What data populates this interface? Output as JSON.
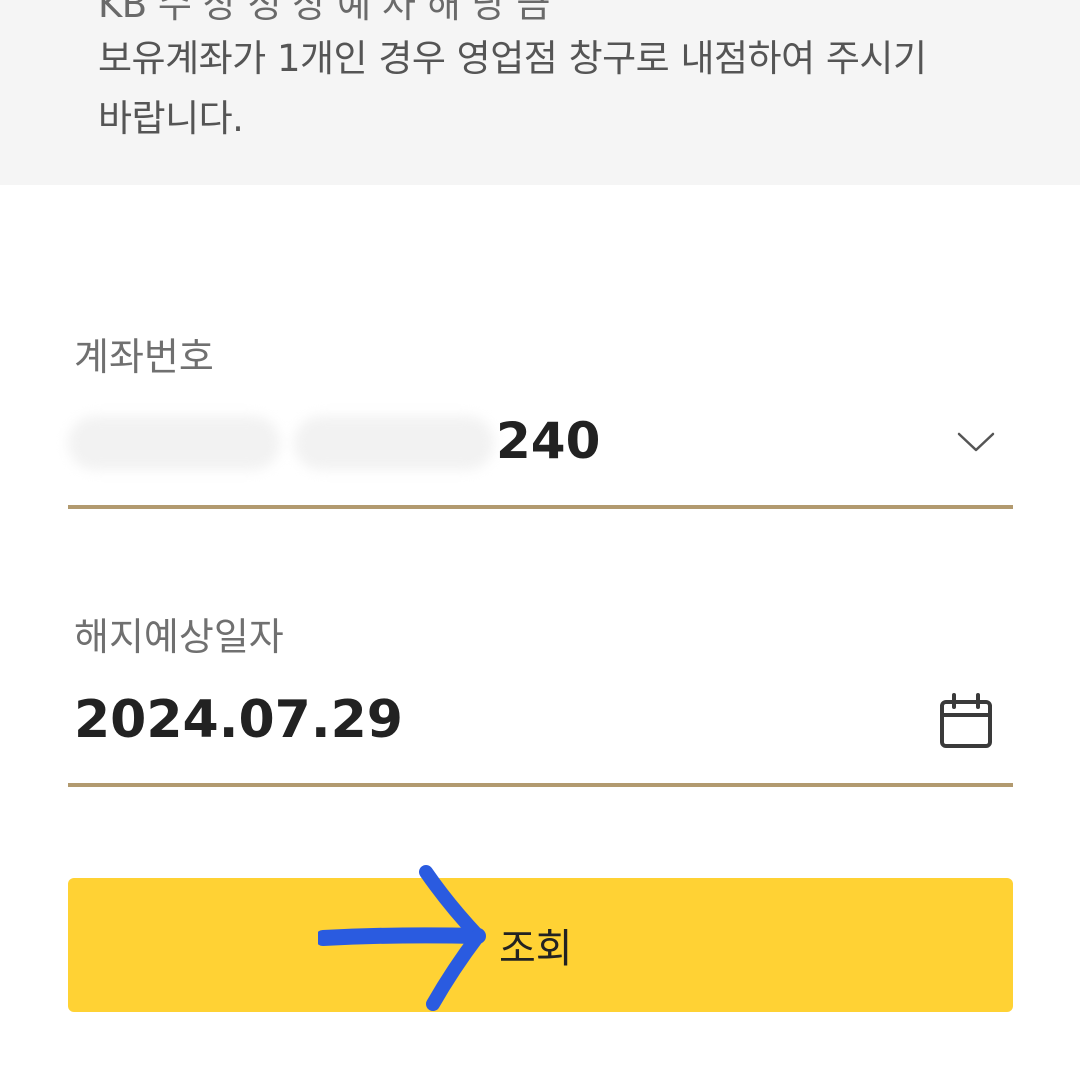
{
  "notice": {
    "cut_line": "KB 수 상 정 상 예 차 해 당 금",
    "line2": "보유계좌가 1개인 경우 영업점 창구로 내점하여 주시기",
    "line3": "바랍니다."
  },
  "account": {
    "label": "계좌번호",
    "value_visible": "240",
    "dropdown_icon": "chevron-down-icon"
  },
  "closing_date": {
    "label": "해지예상일자",
    "value": "2024.07.29",
    "calendar_icon": "calendar-icon"
  },
  "search_button": {
    "label": "조회",
    "background": "#ffd234"
  },
  "annotation": {
    "arrow_icon": "hand-drawn-arrow-icon",
    "arrow_color": "#2a5be0"
  },
  "colors": {
    "underline": "#b29a6f",
    "notice_background": "#f5f5f5"
  }
}
